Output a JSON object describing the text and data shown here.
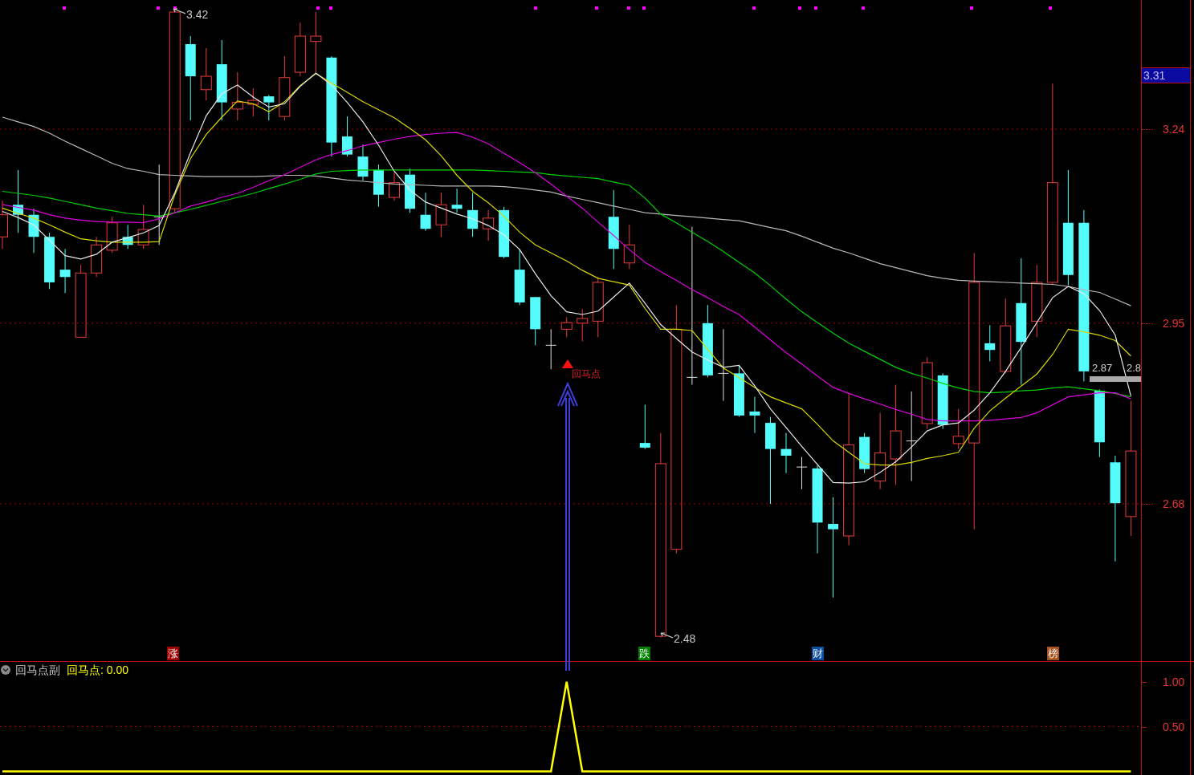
{
  "main_chart": {
    "price_axis": {
      "current_price": "3.31"
    },
    "chart_data": {
      "type": "candlestick",
      "grid": true,
      "ylim": [
        2.445,
        3.433
      ],
      "yticks": [
        {
          "value": 3.24,
          "label": "3.24"
        },
        {
          "value": 2.95,
          "label": "2.95"
        },
        {
          "value": 2.68,
          "label": "2.68"
        }
      ],
      "ohlc": [
        [
          3.079,
          3.133,
          3.061,
          3.112
        ],
        [
          3.127,
          3.179,
          3.085,
          3.112
        ],
        [
          3.112,
          3.121,
          3.055,
          3.079
        ],
        [
          3.079,
          3.085,
          3.001,
          3.011
        ],
        [
          3.03,
          3.061,
          2.995,
          3.019
        ],
        [
          2.929,
          3.037,
          2.929,
          3.025
        ],
        [
          3.025,
          3.079,
          3.019,
          3.067
        ],
        [
          3.059,
          3.109,
          3.055,
          3.1
        ],
        [
          3.079,
          3.097,
          3.061,
          3.067
        ],
        [
          3.067,
          3.127,
          3.061,
          3.09
        ],
        [
          3.109,
          3.187,
          3.067,
          3.109
        ],
        [
          3.121,
          3.42,
          3.115,
          3.415
        ],
        [
          3.367,
          3.379,
          3.253,
          3.319
        ],
        [
          3.299,
          3.361,
          3.283,
          3.319
        ],
        [
          3.337,
          3.373,
          3.253,
          3.28
        ],
        [
          3.27,
          3.325,
          3.253,
          3.28
        ],
        [
          3.277,
          3.301,
          3.259,
          3.283
        ],
        [
          3.289,
          3.291,
          3.253,
          3.28
        ],
        [
          3.259,
          3.349,
          3.253,
          3.317
        ],
        [
          3.325,
          3.399,
          3.319,
          3.379
        ],
        [
          3.371,
          3.415,
          3.325,
          3.379
        ],
        [
          3.347,
          3.349,
          3.199,
          3.22
        ],
        [
          3.229,
          3.259,
          3.199,
          3.202
        ],
        [
          3.199,
          3.217,
          3.163,
          3.169
        ],
        [
          3.179,
          3.187,
          3.124,
          3.142
        ],
        [
          3.138,
          3.175,
          3.133,
          3.16
        ],
        [
          3.172,
          3.181,
          3.115,
          3.121
        ],
        [
          3.112,
          3.145,
          3.088,
          3.091
        ],
        [
          3.097,
          3.145,
          3.079,
          3.127
        ],
        [
          3.127,
          3.151,
          3.115,
          3.121
        ],
        [
          3.119,
          3.145,
          3.079,
          3.091
        ],
        [
          3.091,
          3.119,
          3.073,
          3.107
        ],
        [
          3.119,
          3.124,
          3.047,
          3.049
        ],
        [
          3.03,
          3.061,
          2.977,
          2.981
        ],
        [
          2.989,
          2.989,
          2.917,
          2.941
        ],
        [
          2.917,
          2.941,
          2.881,
          2.917
        ],
        [
          2.941,
          2.959,
          2.929,
          2.951
        ],
        [
          2.95,
          2.971,
          2.923,
          2.957
        ],
        [
          2.953,
          3.019,
          2.929,
          3.011
        ],
        [
          3.109,
          3.149,
          3.031,
          3.061
        ],
        [
          3.04,
          3.097,
          3.031,
          3.067
        ],
        [
          2.771,
          2.828,
          2.762,
          2.764
        ],
        [
          2.482,
          2.786,
          2.48,
          2.74
        ],
        [
          2.612,
          2.977,
          2.606,
          2.941
        ],
        [
          2.869,
          3.094,
          2.858,
          2.869
        ],
        [
          2.95,
          2.977,
          2.869,
          2.872
        ],
        [
          2.875,
          2.941,
          2.834,
          2.875
        ],
        [
          2.875,
          2.887,
          2.81,
          2.812
        ],
        [
          2.818,
          2.84,
          2.786,
          2.812
        ],
        [
          2.801,
          2.81,
          2.68,
          2.762
        ],
        [
          2.762,
          2.786,
          2.726,
          2.752
        ],
        [
          2.735,
          2.75,
          2.702,
          2.735
        ],
        [
          2.733,
          2.738,
          2.606,
          2.652
        ],
        [
          2.65,
          2.69,
          2.54,
          2.642
        ],
        [
          2.632,
          2.846,
          2.618,
          2.768
        ],
        [
          2.78,
          2.786,
          2.726,
          2.732
        ],
        [
          2.714,
          2.816,
          2.702,
          2.756
        ],
        [
          2.747,
          2.858,
          2.708,
          2.789
        ],
        [
          2.774,
          2.848,
          2.714,
          2.774
        ],
        [
          2.8,
          2.899,
          2.792,
          2.891
        ],
        [
          2.872,
          2.875,
          2.792,
          2.798
        ],
        [
          2.77,
          2.822,
          2.762,
          2.781
        ],
        [
          2.771,
          3.055,
          2.642,
          3.011
        ],
        [
          2.92,
          2.947,
          2.893,
          2.91
        ],
        [
          2.878,
          2.987,
          2.875,
          2.946
        ],
        [
          2.98,
          3.047,
          2.858,
          2.922
        ],
        [
          2.953,
          3.037,
          2.929,
          3.011
        ],
        [
          3.011,
          3.308,
          3.007,
          3.16
        ],
        [
          3.1,
          3.179,
          3.007,
          3.022
        ],
        [
          3.1,
          3.119,
          2.863,
          2.878
        ],
        [
          2.849,
          2.851,
          2.75,
          2.772
        ],
        [
          2.742,
          2.752,
          2.594,
          2.681
        ],
        [
          2.661,
          2.834,
          2.632,
          2.759
        ]
      ],
      "series": [
        {
          "type": "line",
          "color": "#b8b8b8",
          "values": [
            3.258,
            3.251,
            3.244,
            3.234,
            3.222,
            3.211,
            3.2,
            3.189,
            3.181,
            3.177,
            3.172,
            3.171,
            3.17,
            3.169,
            3.169,
            3.169,
            3.169,
            3.17,
            3.171,
            3.171,
            3.17,
            3.167,
            3.164,
            3.162,
            3.16,
            3.158,
            3.157,
            3.156,
            3.155,
            3.155,
            3.155,
            3.155,
            3.154,
            3.152,
            3.149,
            3.146,
            3.14,
            3.135,
            3.13,
            3.125,
            3.12,
            3.115,
            3.113,
            3.111,
            3.109,
            3.107,
            3.105,
            3.103,
            3.098,
            3.093,
            3.088,
            3.08,
            3.071,
            3.062,
            3.055,
            3.047,
            3.039,
            3.033,
            3.027,
            3.021,
            3.017,
            3.014,
            3.013,
            3.012,
            3.011,
            3.01,
            3.009,
            3.008,
            3.005,
            3.0,
            2.996,
            2.986,
            2.976
          ]
        },
        {
          "type": "line",
          "color": "#00d000",
          "values": [
            3.147,
            3.144,
            3.141,
            3.137,
            3.132,
            3.127,
            3.122,
            3.118,
            3.114,
            3.112,
            3.11,
            3.115,
            3.12,
            3.126,
            3.132,
            3.138,
            3.144,
            3.151,
            3.158,
            3.165,
            3.173,
            3.177,
            3.178,
            3.179,
            3.179,
            3.179,
            3.179,
            3.179,
            3.179,
            3.179,
            3.179,
            3.178,
            3.177,
            3.176,
            3.175,
            3.172,
            3.17,
            3.168,
            3.166,
            3.161,
            3.156,
            3.137,
            3.113,
            3.1,
            3.086,
            3.072,
            3.057,
            3.041,
            3.025,
            3.006,
            2.986,
            2.967,
            2.951,
            2.935,
            2.92,
            2.908,
            2.896,
            2.884,
            2.875,
            2.868,
            2.86,
            2.853,
            2.848,
            2.846,
            2.847,
            2.849,
            2.85,
            2.853,
            2.855,
            2.852,
            2.849,
            2.845,
            2.84
          ]
        },
        {
          "type": "line",
          "color": "#e000e0",
          "values": [
            3.127,
            3.123,
            3.119,
            3.112,
            3.107,
            3.104,
            3.102,
            3.101,
            3.101,
            3.1,
            3.106,
            3.115,
            3.125,
            3.131,
            3.138,
            3.144,
            3.153,
            3.163,
            3.172,
            3.183,
            3.194,
            3.202,
            3.208,
            3.215,
            3.22,
            3.225,
            3.229,
            3.232,
            3.234,
            3.235,
            3.228,
            3.218,
            3.204,
            3.19,
            3.175,
            3.158,
            3.14,
            3.122,
            3.101,
            3.081,
            3.06,
            3.041,
            3.027,
            3.014,
            3.0,
            2.988,
            2.975,
            2.963,
            2.944,
            2.925,
            2.906,
            2.889,
            2.871,
            2.854,
            2.845,
            2.837,
            2.829,
            2.821,
            2.814,
            2.806,
            2.804,
            2.804,
            2.804,
            2.805,
            2.807,
            2.809,
            2.816,
            2.828,
            2.84,
            2.843,
            2.846,
            2.846,
            2.837
          ]
        },
        {
          "type": "line",
          "color": "#d8d800",
          "values": [
            3.122,
            3.114,
            3.107,
            3.097,
            3.086,
            3.076,
            3.073,
            3.071,
            3.071,
            3.071,
            3.072,
            3.142,
            3.196,
            3.232,
            3.258,
            3.282,
            3.278,
            3.266,
            3.281,
            3.305,
            3.323,
            3.309,
            3.295,
            3.281,
            3.269,
            3.257,
            3.241,
            3.224,
            3.2,
            3.171,
            3.147,
            3.13,
            3.11,
            3.086,
            3.067,
            3.055,
            3.043,
            3.029,
            3.017,
            3.012,
            3.007,
            2.972,
            2.941,
            2.941,
            2.939,
            2.911,
            2.883,
            2.869,
            2.854,
            2.84,
            2.831,
            2.822,
            2.799,
            2.774,
            2.757,
            2.74,
            2.738,
            2.738,
            2.742,
            2.748,
            2.752,
            2.757,
            2.793,
            2.819,
            2.838,
            2.856,
            2.874,
            2.903,
            2.941,
            2.937,
            2.932,
            2.924,
            2.901
          ]
        },
        {
          "type": "line",
          "color": "#e8e8e8",
          "values": [
            3.117,
            3.108,
            3.097,
            3.074,
            3.051,
            3.046,
            3.053,
            3.071,
            3.078,
            3.085,
            3.096,
            3.145,
            3.205,
            3.26,
            3.293,
            3.306,
            3.288,
            3.273,
            3.278,
            3.304,
            3.324,
            3.306,
            3.28,
            3.251,
            3.216,
            3.177,
            3.149,
            3.131,
            3.122,
            3.113,
            3.106,
            3.096,
            3.082,
            3.06,
            3.024,
            2.991,
            2.967,
            2.963,
            2.968,
            2.989,
            3.01,
            2.98,
            2.948,
            2.927,
            2.907,
            2.895,
            2.884,
            2.887,
            2.856,
            2.822,
            2.794,
            2.766,
            2.739,
            2.712,
            2.711,
            2.713,
            2.727,
            2.743,
            2.765,
            2.789,
            2.798,
            2.801,
            2.82,
            2.846,
            2.878,
            2.914,
            2.951,
            2.988,
            3.005,
            2.994,
            2.969,
            2.932,
            2.841
          ]
        }
      ]
    },
    "annotations": [
      {
        "kind": "extreme",
        "text": "3.42"
      },
      {
        "kind": "extreme",
        "text": "2.48"
      },
      {
        "kind": "level",
        "text": "2.87"
      },
      {
        "kind": "level",
        "text": "2.8"
      }
    ],
    "signal": {
      "label": "回马点"
    },
    "signal_tags": [
      {
        "text": "涨",
        "color": "#a00000"
      },
      {
        "text": "跌",
        "color": "#008000"
      },
      {
        "text": "财",
        "color": "#0a4fa0"
      },
      {
        "text": "榜",
        "color": "#a8501e"
      }
    ]
  },
  "indicator_panel": {
    "title": "回马点副",
    "legend_value": ": 0.00",
    "chart_data": {
      "type": "line",
      "ylim": [
        -0.04,
        1.22
      ],
      "yticks": [
        {
          "value": 0.5,
          "label": "0.50"
        },
        {
          "value": 1,
          "label": "1.00"
        }
      ],
      "ref_lines": [
        {
          "axis": "y",
          "value": 0.5
        }
      ],
      "series": [
        {
          "name": "回马点",
          "color": "#ffff00",
          "values": [
            0,
            0,
            0,
            0,
            0,
            0,
            0,
            0,
            0,
            0,
            0,
            0,
            0,
            0,
            0,
            0,
            0,
            0,
            0,
            0,
            0,
            0,
            0,
            0,
            0,
            0,
            0,
            0,
            0,
            0,
            0,
            0,
            0,
            0,
            0,
            0,
            1,
            0,
            0,
            0,
            0,
            0,
            0,
            0,
            0,
            0,
            0,
            0,
            0,
            0,
            0,
            0,
            0,
            0,
            0,
            0,
            0,
            0,
            0,
            0,
            0,
            0,
            0,
            0,
            0,
            0,
            0,
            0,
            0,
            0,
            0,
            0,
            0
          ]
        }
      ]
    }
  }
}
